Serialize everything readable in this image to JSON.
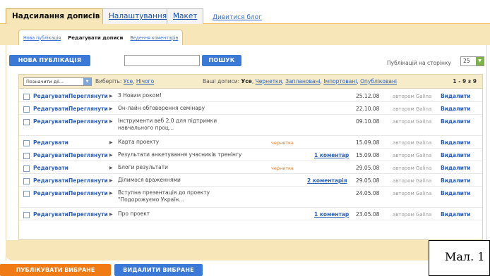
{
  "tabs": [
    {
      "label": "Надсилання дописів",
      "active": true
    },
    {
      "label": "Налаштування",
      "active": false
    },
    {
      "label": "Макет",
      "active": false
    },
    {
      "label": "Дивитися блог",
      "active": false
    }
  ],
  "subtabs": {
    "new_post": "Нова публікація",
    "edit_posts": "Редагувати дописи",
    "moderate_comments": "Ведення коментарів"
  },
  "toolbar": {
    "new_post_button": "НОВА ПУБЛІКАЦІЯ",
    "search_button": "ПОШУК",
    "search_value": "",
    "per_page_label": "Публікацій на сторінку",
    "per_page_value": "25"
  },
  "list_header": {
    "bulk_placeholder": "Позначити дії...",
    "select_label": "Виберіть:",
    "select_all": "Усе",
    "select_none": "Нічого",
    "your_posts_label": "Ваші дописи:",
    "filter_all": "Усе",
    "filter_drafts": "Чернетки",
    "filter_scheduled": "Заплановані",
    "filter_imported": "Імпортовані",
    "filter_published": "Опубліковані",
    "count": "1 - 9 з 9"
  },
  "row_labels": {
    "edit": "Редагувати",
    "view": "Переглянути",
    "delete": "Видалити"
  },
  "posts": [
    {
      "title": "З Новим роком!",
      "status": "",
      "comments": "",
      "date": "25.12.08",
      "author": "автором Galina",
      "has_view": true
    },
    {
      "title": "Он-лайн обговорення семінару",
      "status": "",
      "comments": "",
      "date": "22.10.08",
      "author": "автором Galina",
      "has_view": true
    },
    {
      "title": "Інструменти веб 2.0 для підтримки навчального проц...",
      "status": "",
      "comments": "",
      "date": "09.10.08",
      "author": "автором Galina",
      "has_view": true
    },
    {
      "title": "Карта проекту",
      "status": "чернетка",
      "comments": "",
      "date": "15.09.08",
      "author": "автором Galina",
      "has_view": false
    },
    {
      "title": "Результати анкетування учасників тренінгу",
      "status": "",
      "comments": "1 коментар",
      "date": "15.09.08",
      "author": "автором Galina",
      "has_view": true
    },
    {
      "title": "Блоги результати",
      "status": "чернетка",
      "comments": "",
      "date": "29.05.08",
      "author": "автором Galina",
      "has_view": false
    },
    {
      "title": "Ділимося враженнями",
      "status": "",
      "comments": "2 коментарія",
      "date": "29.05.08",
      "author": "автором Galina",
      "has_view": true
    },
    {
      "title": "Вступна презентація до проекту \"Подорожуємо Україн...",
      "status": "",
      "comments": "",
      "date": "24.05.08",
      "author": "автором Galina",
      "has_view": true
    },
    {
      "title": "Про проект",
      "status": "",
      "comments": "1 коментар",
      "date": "23.05.08",
      "author": "автором Galina",
      "has_view": true
    }
  ],
  "bottom": {
    "publish_selected": "ПУБЛІКУВАТИ ВИБРАНЕ",
    "delete_selected": "ВИДАЛИТИ ВИБРАНЕ"
  },
  "caption": "Мал. 1"
}
